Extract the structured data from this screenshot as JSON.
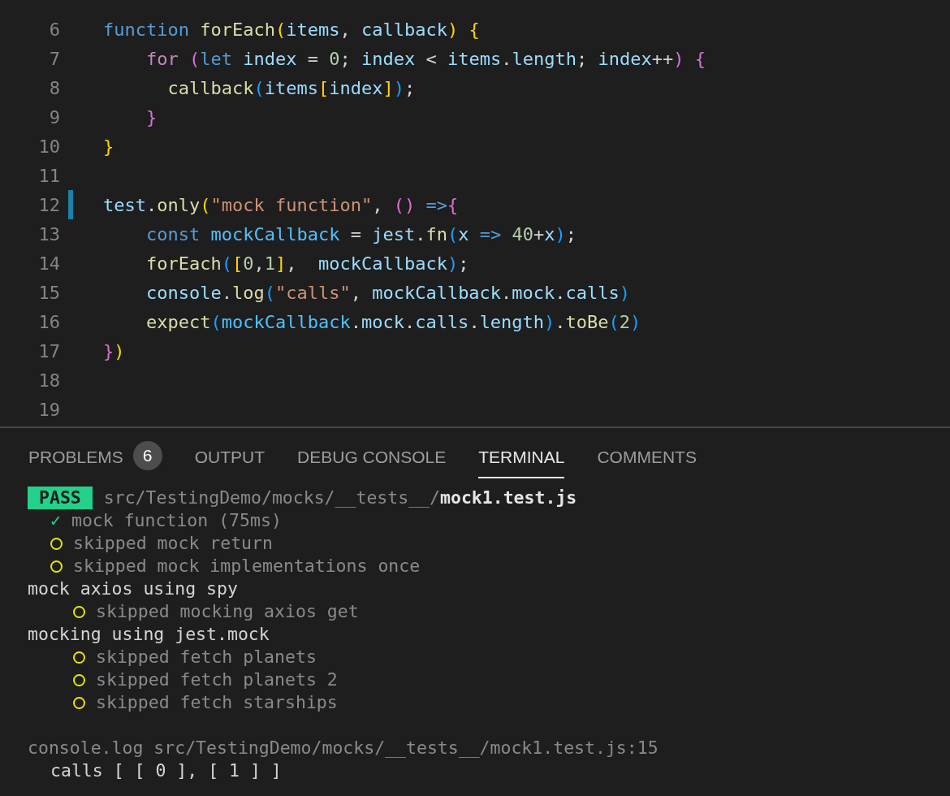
{
  "editor": {
    "lines": [
      {
        "number": "6",
        "modified": false,
        "tokens": [
          {
            "text": "function",
            "kind": "keyword"
          },
          {
            "text": " forEach",
            "kind": "func"
          },
          {
            "text": "(",
            "kind": "b1"
          },
          {
            "text": "items",
            "kind": "var"
          },
          {
            "text": ",",
            "kind": "plain"
          },
          {
            "text": " callback",
            "kind": "var"
          },
          {
            "text": ")",
            "kind": "b1"
          },
          {
            "text": " {",
            "kind": "b1"
          }
        ]
      },
      {
        "number": "7",
        "modified": false,
        "tokens": [
          {
            "text": "    for",
            "kind": "control"
          },
          {
            "text": " (",
            "kind": "b2"
          },
          {
            "text": "let",
            "kind": "keyword"
          },
          {
            "text": " index",
            "kind": "var"
          },
          {
            "text": " = ",
            "kind": "plain"
          },
          {
            "text": "0",
            "kind": "num"
          },
          {
            "text": "; ",
            "kind": "plain"
          },
          {
            "text": "index",
            "kind": "var"
          },
          {
            "text": " < ",
            "kind": "plain"
          },
          {
            "text": "items",
            "kind": "var"
          },
          {
            "text": ".",
            "kind": "plain"
          },
          {
            "text": "length",
            "kind": "var"
          },
          {
            "text": "; ",
            "kind": "plain"
          },
          {
            "text": "index",
            "kind": "var"
          },
          {
            "text": "++",
            "kind": "plain"
          },
          {
            "text": ")",
            "kind": "b2"
          },
          {
            "text": " {",
            "kind": "b2"
          }
        ]
      },
      {
        "number": "8",
        "modified": false,
        "tokens": [
          {
            "text": "      callback",
            "kind": "func"
          },
          {
            "text": "(",
            "kind": "b3"
          },
          {
            "text": "items",
            "kind": "var"
          },
          {
            "text": "[",
            "kind": "b1"
          },
          {
            "text": "index",
            "kind": "var"
          },
          {
            "text": "]",
            "kind": "b1"
          },
          {
            "text": ")",
            "kind": "b3"
          },
          {
            "text": ";",
            "kind": "plain"
          }
        ]
      },
      {
        "number": "9",
        "modified": false,
        "tokens": [
          {
            "text": "    }",
            "kind": "b2"
          }
        ]
      },
      {
        "number": "10",
        "modified": false,
        "tokens": [
          {
            "text": "}",
            "kind": "b1"
          }
        ]
      },
      {
        "number": "11",
        "modified": false
      },
      {
        "number": "12",
        "modified": true,
        "tokens": [
          {
            "text": "test",
            "kind": "var"
          },
          {
            "text": ".",
            "kind": "plain"
          },
          {
            "text": "only",
            "kind": "func"
          },
          {
            "text": "(",
            "kind": "b1"
          },
          {
            "text": "\"mock function\"",
            "kind": "str"
          },
          {
            "text": ",",
            "kind": "plain"
          },
          {
            "text": " ()",
            "kind": "b2"
          },
          {
            "text": " =>",
            "kind": "keyword"
          },
          {
            "text": "{",
            "kind": "b2"
          }
        ]
      },
      {
        "number": "13",
        "modified": false,
        "tokens": [
          {
            "text": "    const",
            "kind": "keyword"
          },
          {
            "text": " mockCallback",
            "kind": "const"
          },
          {
            "text": " = ",
            "kind": "plain"
          },
          {
            "text": "jest",
            "kind": "var"
          },
          {
            "text": ".",
            "kind": "plain"
          },
          {
            "text": "fn",
            "kind": "func"
          },
          {
            "text": "(",
            "kind": "b3"
          },
          {
            "text": "x",
            "kind": "var"
          },
          {
            "text": " =>",
            "kind": "keyword"
          },
          {
            "text": " 40",
            "kind": "num"
          },
          {
            "text": "+",
            "kind": "plain"
          },
          {
            "text": "x",
            "kind": "var"
          },
          {
            "text": ")",
            "kind": "b3"
          },
          {
            "text": ";",
            "kind": "plain"
          }
        ]
      },
      {
        "number": "14",
        "modified": false,
        "tokens": [
          {
            "text": "    forEach",
            "kind": "func"
          },
          {
            "text": "(",
            "kind": "b3"
          },
          {
            "text": "[",
            "kind": "b1"
          },
          {
            "text": "0",
            "kind": "num"
          },
          {
            "text": ",",
            "kind": "plain"
          },
          {
            "text": "1",
            "kind": "num"
          },
          {
            "text": "]",
            "kind": "b1"
          },
          {
            "text": ",",
            "kind": "plain"
          },
          {
            "text": "  mockCallback",
            "kind": "var"
          },
          {
            "text": ")",
            "kind": "b3"
          },
          {
            "text": ";",
            "kind": "plain"
          }
        ]
      },
      {
        "number": "15",
        "modified": false,
        "tokens": [
          {
            "text": "    console",
            "kind": "var"
          },
          {
            "text": ".",
            "kind": "plain"
          },
          {
            "text": "log",
            "kind": "func"
          },
          {
            "text": "(",
            "kind": "b3"
          },
          {
            "text": "\"calls\"",
            "kind": "str"
          },
          {
            "text": ",",
            "kind": "plain"
          },
          {
            "text": " mockCallback",
            "kind": "var"
          },
          {
            "text": ".",
            "kind": "plain"
          },
          {
            "text": "mock",
            "kind": "var"
          },
          {
            "text": ".",
            "kind": "plain"
          },
          {
            "text": "calls",
            "kind": "var"
          },
          {
            "text": ")",
            "kind": "b3"
          }
        ]
      },
      {
        "number": "16",
        "modified": false,
        "tokens": [
          {
            "text": "    expect",
            "kind": "func"
          },
          {
            "text": "(",
            "kind": "b3"
          },
          {
            "text": "mockCallback",
            "kind": "const"
          },
          {
            "text": ".",
            "kind": "plain"
          },
          {
            "text": "mock",
            "kind": "var"
          },
          {
            "text": ".",
            "kind": "plain"
          },
          {
            "text": "calls",
            "kind": "var"
          },
          {
            "text": ".",
            "kind": "plain"
          },
          {
            "text": "length",
            "kind": "var"
          },
          {
            "text": ")",
            "kind": "b3"
          },
          {
            "text": ".",
            "kind": "plain"
          },
          {
            "text": "toBe",
            "kind": "func"
          },
          {
            "text": "(",
            "kind": "b3"
          },
          {
            "text": "2",
            "kind": "num"
          },
          {
            "text": ")",
            "kind": "b3"
          }
        ]
      },
      {
        "number": "17",
        "modified": false,
        "tokens": [
          {
            "text": "}",
            "kind": "b2"
          },
          {
            "text": ")",
            "kind": "b1"
          }
        ]
      },
      {
        "number": "18",
        "modified": false
      },
      {
        "number": "19",
        "modified": false
      }
    ]
  },
  "panel": {
    "tabs": [
      {
        "label": "PROBLEMS",
        "badge": "6",
        "selected": false
      },
      {
        "label": "OUTPUT",
        "selected": false
      },
      {
        "label": "DEBUG CONSOLE",
        "selected": false
      },
      {
        "label": "TERMINAL",
        "selected": true
      },
      {
        "label": "COMMENTS",
        "selected": false
      }
    ],
    "terminal": {
      "status": "PASS",
      "path": "src/TestingDemo/mocks/__tests__/",
      "file": "mock1.test.js",
      "results": [
        {
          "kind": "passed",
          "mark": "✓",
          "label": "mock function (75ms)"
        },
        {
          "kind": "skipped",
          "label": "skipped mock return"
        },
        {
          "kind": "skipped",
          "label": "skipped mock implementations once"
        },
        {
          "kind": "group",
          "label": "mock axios using spy",
          "children": [
            {
              "kind": "skipped",
              "label": "skipped mocking axios get"
            }
          ]
        },
        {
          "kind": "group",
          "label": "mocking using jest.mock",
          "children": [
            {
              "kind": "skipped",
              "label": "skipped fetch planets"
            },
            {
              "kind": "skipped",
              "label": "skipped fetch planets 2"
            },
            {
              "kind": "skipped",
              "label": "skipped fetch starships"
            }
          ]
        }
      ],
      "console_source": "console.log src/TestingDemo/mocks/__tests__/mock1.test.js:15",
      "console_output": "calls [ [ 0 ], [ 1 ] ]"
    }
  }
}
